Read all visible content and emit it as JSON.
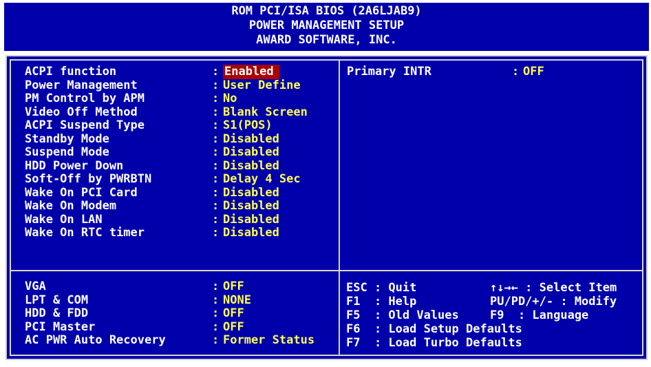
{
  "header": {
    "line1": "ROM PCI/ISA BIOS (2A6LJAB9)",
    "line2": "POWER MANAGEMENT SETUP",
    "line3": "AWARD SOFTWARE, INC."
  },
  "settings": [
    {
      "label": "ACPI function",
      "value": "Enabled",
      "selected": true
    },
    {
      "label": "Power Management",
      "value": "User Define"
    },
    {
      "label": "PM Control by APM",
      "value": "No"
    },
    {
      "label": "Video Off Method",
      "value": "Blank Screen"
    },
    {
      "label": "ACPI Suspend Type",
      "value": "S1(POS)"
    },
    {
      "label": "Standby Mode",
      "value": "Disabled"
    },
    {
      "label": "Suspend Mode",
      "value": "Disabled"
    },
    {
      "label": "HDD Power Down",
      "value": "Disabled"
    },
    {
      "label": "Soft-Off by PWRBTN",
      "value": "Delay 4 Sec"
    },
    {
      "label": "Wake On PCI Card",
      "value": "Disabled"
    },
    {
      "label": "Wake On Modem",
      "value": "Disabled"
    },
    {
      "label": "Wake On LAN",
      "value": "Disabled"
    },
    {
      "label": "Wake On RTC timer",
      "value": "Disabled"
    }
  ],
  "right_settings": [
    {
      "label": "Primary INTR",
      "value": "OFF"
    }
  ],
  "bottom_settings": [
    {
      "label": "VGA",
      "value": "OFF"
    },
    {
      "label": "LPT & COM",
      "value": "NONE"
    },
    {
      "label": "HDD & FDD",
      "value": "OFF"
    },
    {
      "label": "PCI Master",
      "value": "OFF"
    },
    {
      "label": "AC PWR Auto Recovery",
      "value": "Former Status"
    }
  ],
  "help": {
    "left": [
      "ESC : Quit",
      "F1  : Help",
      "F5  : Old Values",
      "F6  : Load Setup Defaults",
      "F7  : Load Turbo Defaults"
    ],
    "right": [
      "↑↓→← : Select Item",
      "PU/PD/+/- : Modify",
      "F9  : Language"
    ]
  },
  "colors": {
    "background": "#0000aa",
    "label": "#ffffff",
    "value": "#ffff55",
    "selected": "#aa0000"
  }
}
